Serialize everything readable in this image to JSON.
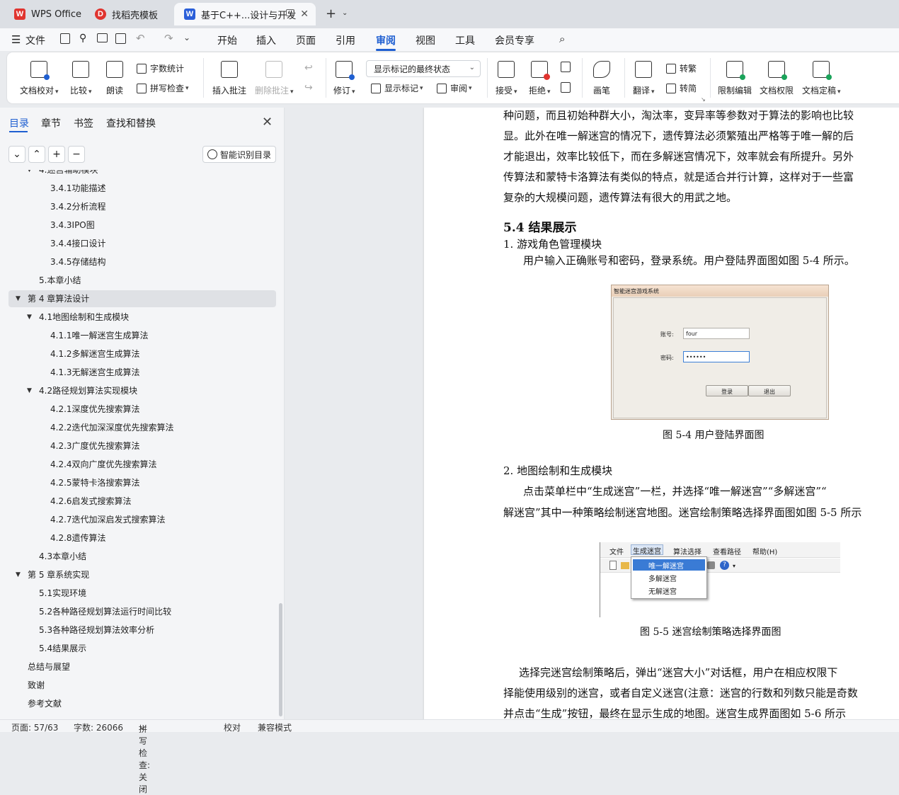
{
  "tabs": [
    {
      "label": "WPS Office",
      "icon": "wps-logo-icon"
    },
    {
      "label": "找稻壳模板",
      "icon": "docer-icon"
    },
    {
      "label": "基于C++...设计与开发",
      "icon": "word-doc-icon",
      "active": true
    }
  ],
  "menubar": {
    "file_label": "文件",
    "items": [
      "开始",
      "插入",
      "页面",
      "引用",
      "审阅",
      "视图",
      "工具",
      "会员专享"
    ],
    "active": "审阅"
  },
  "ribbon": {
    "proofread": "文档校对",
    "compare": "比较",
    "read_aloud": "朗读",
    "word_count": "字数统计",
    "spell_check": "拼写检查",
    "insert_comment": "插入批注",
    "delete_comment": "删除批注",
    "track_changes": "修订",
    "markup_select": "显示标记的最终状态",
    "show_markup": "显示标记",
    "review": "审阅",
    "accept": "接受",
    "reject": "拒绝",
    "pen": "画笔",
    "translate": "翻译",
    "to_traditional": "转繁",
    "to_simplified": "转简",
    "restrict_edit": "限制编辑",
    "doc_permission": "文档权限",
    "doc_finalize": "文档定稿"
  },
  "left_panel": {
    "tabs": [
      "目录",
      "章节",
      "书签",
      "查找和替换"
    ],
    "smart_button": "智能识别目录",
    "toc": [
      {
        "label": "4.迷宫辅助模块",
        "level": 2,
        "expanded": true
      },
      {
        "label": "3.4.1功能描述",
        "level": 3
      },
      {
        "label": "3.4.2分析流程",
        "level": 3
      },
      {
        "label": "3.4.3IPO图",
        "level": 3
      },
      {
        "label": "3.4.4接口设计",
        "level": 3
      },
      {
        "label": "3.4.5存储结构",
        "level": 3
      },
      {
        "label": "5.本章小结",
        "level": 2
      },
      {
        "label": "第 4 章算法设计",
        "level": 1,
        "expanded": true,
        "selected": true
      },
      {
        "label": "4.1地图绘制和生成模块",
        "level": 2,
        "expanded": true
      },
      {
        "label": "4.1.1唯一解迷宫生成算法",
        "level": 3
      },
      {
        "label": "4.1.2多解迷宫生成算法",
        "level": 3
      },
      {
        "label": "4.1.3无解迷宫生成算法",
        "level": 3
      },
      {
        "label": "4.2路径规划算法实现模块",
        "level": 2,
        "expanded": true
      },
      {
        "label": "4.2.1深度优先搜索算法",
        "level": 3
      },
      {
        "label": "4.2.2迭代加深深度优先搜索算法",
        "level": 3
      },
      {
        "label": "4.2.3广度优先搜索算法",
        "level": 3
      },
      {
        "label": "4.2.4双向广度优先搜索算法",
        "level": 3
      },
      {
        "label": "4.2.5蒙特卡洛搜索算法",
        "level": 3
      },
      {
        "label": "4.2.6启发式搜索算法",
        "level": 3
      },
      {
        "label": "4.2.7迭代加深启发式搜索算法",
        "level": 3
      },
      {
        "label": "4.2.8遗传算法",
        "level": 3
      },
      {
        "label": "4.3本章小结",
        "level": 2
      },
      {
        "label": "第 5 章系统实现",
        "level": 1,
        "expanded": true
      },
      {
        "label": "5.1实现环境",
        "level": 2
      },
      {
        "label": "5.2各种路径规划算法运行时间比较",
        "level": 2
      },
      {
        "label": "5.3各种路径规划算法效率分析",
        "level": 2
      },
      {
        "label": "5.4结果展示",
        "level": 2
      },
      {
        "label": "总结与展望",
        "level": 1
      },
      {
        "label": "致谢",
        "level": 1
      },
      {
        "label": "参考文献",
        "level": 1
      }
    ]
  },
  "document": {
    "lines_top": [
      "种问题，而且初始种群大小，淘汰率，变异率等参数对于算法的影响也比较",
      "显。此外在唯一解迷宫的情况下，遗传算法必须繁殖出严格等于唯一解的后",
      "才能退出，效率比较低下，而在多解迷宫情况下，效率就会有所提升。另外",
      "传算法和蒙特卡洛算法有类似的特点，就是适合并行计算，这样对于一些富",
      "复杂的大规模问题，遗传算法有很大的用武之地。"
    ],
    "heading": "5.4  结果展示",
    "item1_title": "1.   游戏角色管理模块",
    "item1_body": "用户输入正确账号和密码，登录系统。用户登陆界面图如图 5-4 所示。",
    "login_figure": {
      "window_title": "智能迷宫游戏系统",
      "account_label": "账号:",
      "account_value": "four",
      "password_label": "密码:",
      "password_value": "••••••",
      "login_button": "登录",
      "exit_button": "退出"
    },
    "caption1": "图 5-4    用户登陆界面图",
    "item2_title": "2.   地图绘制和生成模块",
    "item2_line1": "点击菜单栏中“生成迷宫”一栏，并选择“唯一解迷宫”“多解迷宫”“",
    "item2_line2": "解迷宫”其中一种策略绘制迷宫地图。迷宫绘制策略选择界面图如图 5-5 所示",
    "menu_figure": {
      "menus": [
        "文件",
        "生成迷宫",
        "算法选择",
        "查看路径",
        "帮助(H)"
      ],
      "dropdown": [
        "唯一解迷宫",
        "多解迷宫",
        "无解迷宫"
      ]
    },
    "caption2": "图 5-5    迷宫绘制策略选择界面图",
    "lines_bottom": [
      " 选择完迷宫绘制策略后，弹出“迷宫大小”对话框，用户在相应权限下",
      "择能使用级别的迷宫，或者自定义迷宫(注意：迷宫的行数和列数只能是奇数",
      "并点击“生成”按钮，最终在显示生成的地图。迷宫生成界面图如 5-6 所示"
    ]
  },
  "status": {
    "page": "页面: 57/63",
    "words": "字数: 26066",
    "spell": "拼写检查: 关闭",
    "proof": "校对",
    "compat": "兼容模式"
  },
  "colors": {
    "accent": "#1f5fd1",
    "wps_red": "#e0342f",
    "word_blue": "#2b5fd9"
  }
}
